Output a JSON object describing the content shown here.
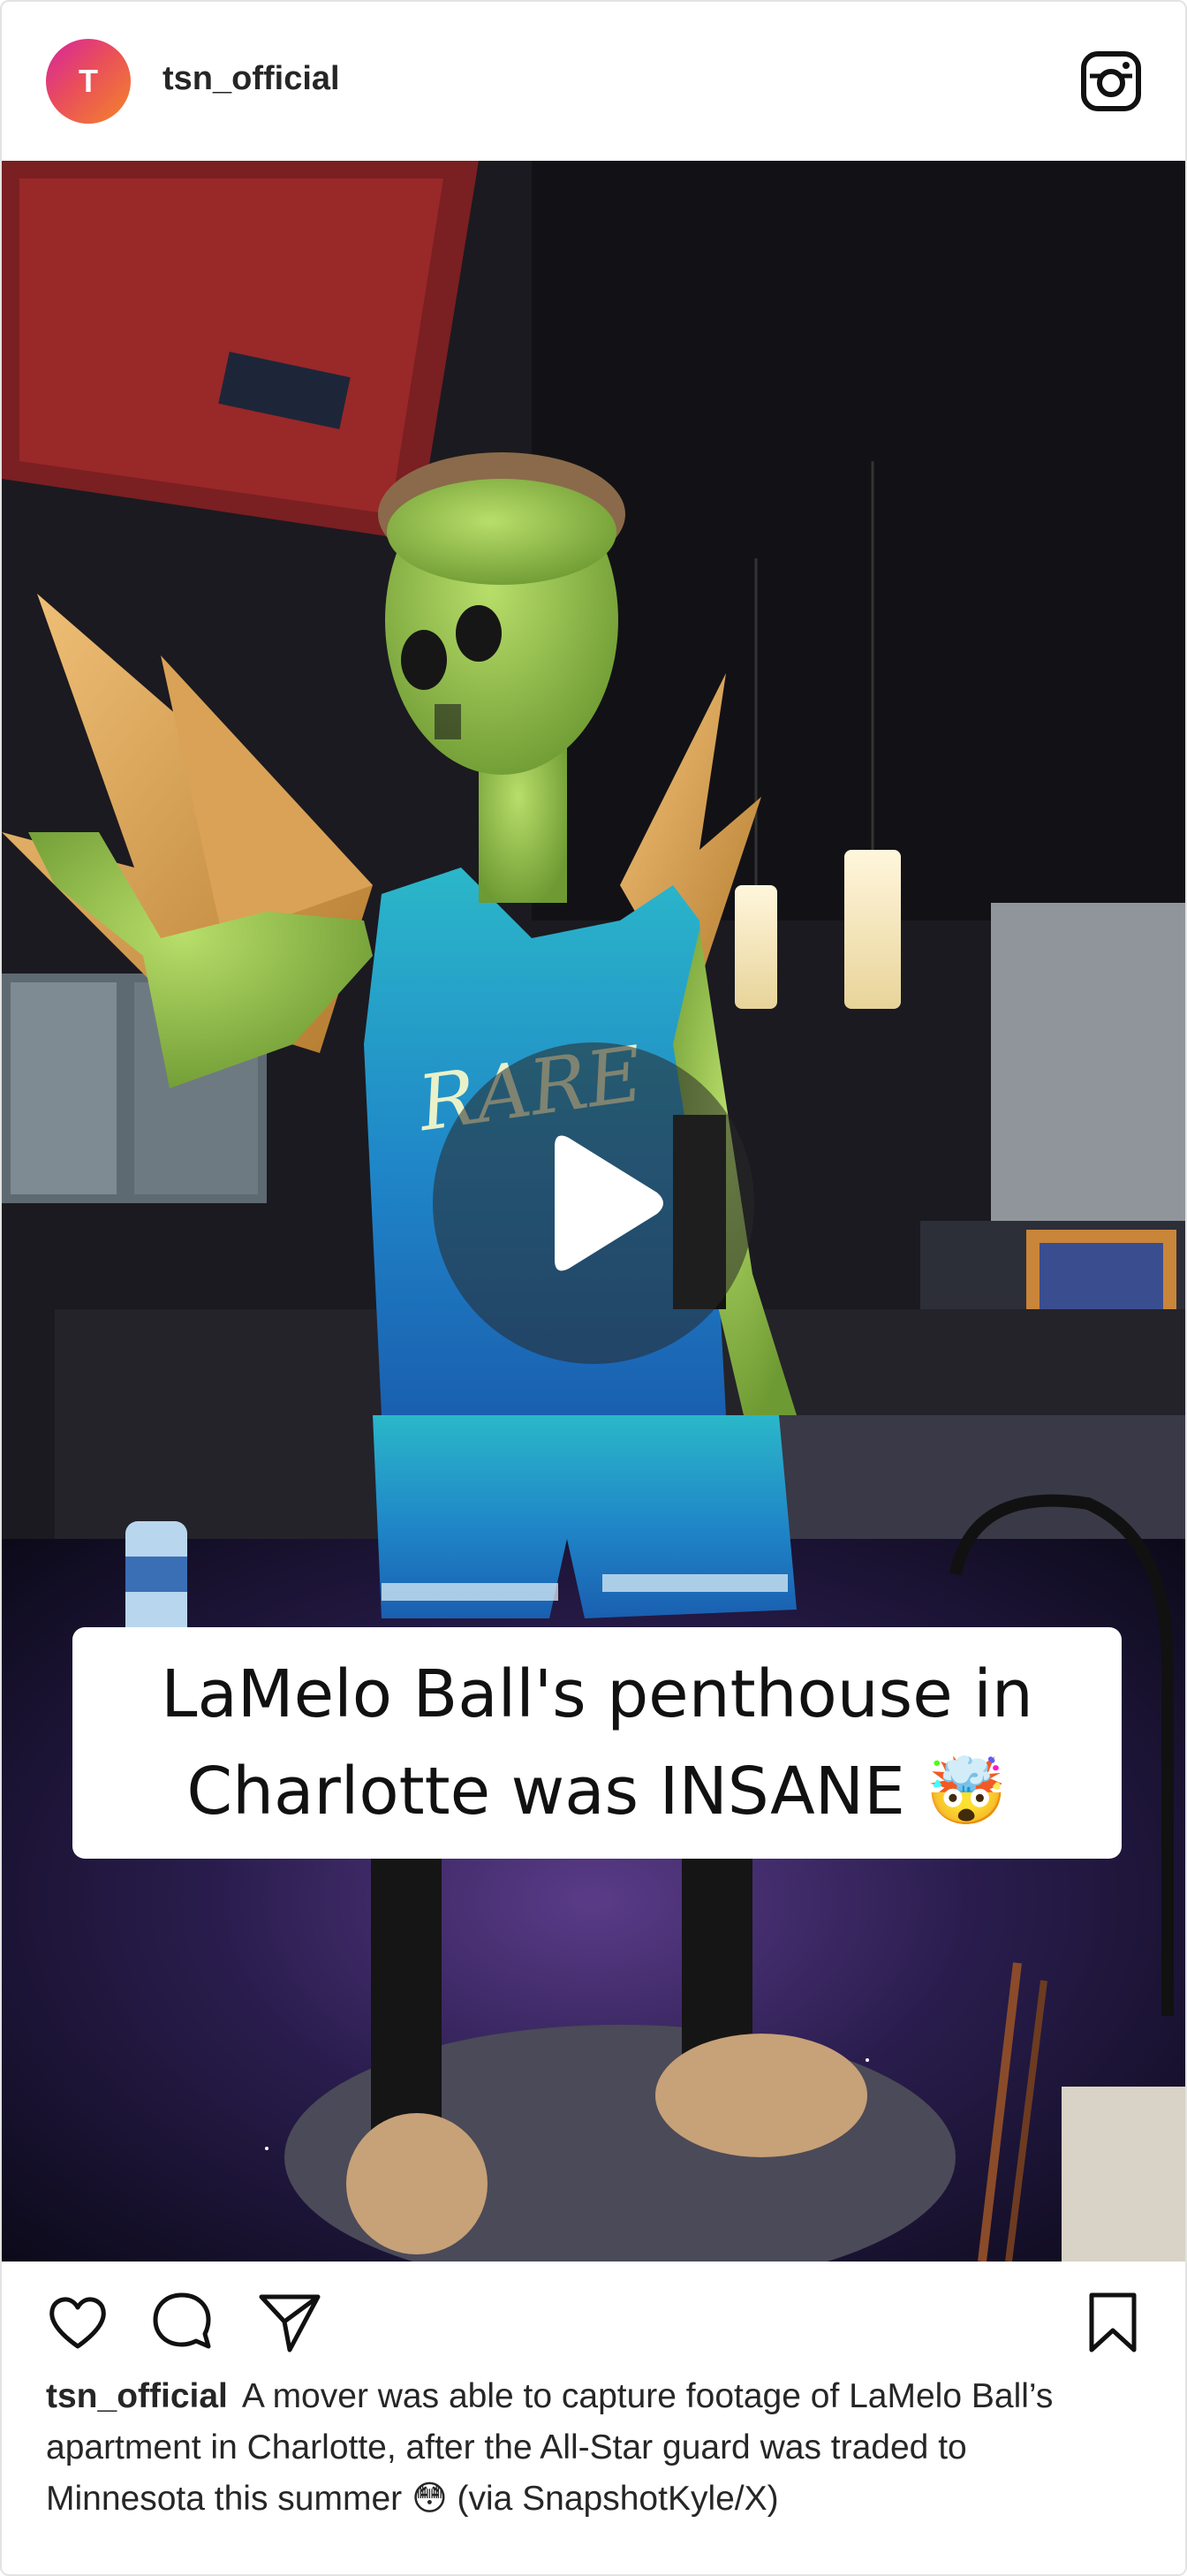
{
  "post": {
    "avatar_letter": "T",
    "username": "tsn_official",
    "overlay_text_line1": "LaMelo Ball's penthouse in",
    "overlay_text_line2": "Charlotte was INSANE",
    "overlay_emoji": "🤯",
    "caption_user": "tsn_official",
    "caption_text": "A mover was able to capture footage of LaMelo Ball’s apartment in Charlotte, after the All-Star guard was traded to Minnesota this summer 😳 (via SnapshotKyle/X)",
    "jersey_text": "RARE"
  },
  "icons": {
    "header": "instagram-icon",
    "media": "play-icon",
    "actions": [
      "heart-icon",
      "comment-icon",
      "share-icon",
      "bookmark-icon"
    ]
  },
  "colors": {
    "avatar_gradient_start": "#d6249f",
    "avatar_gradient_end": "#f58529",
    "text": "#262626",
    "border": "#e3e3e3"
  }
}
